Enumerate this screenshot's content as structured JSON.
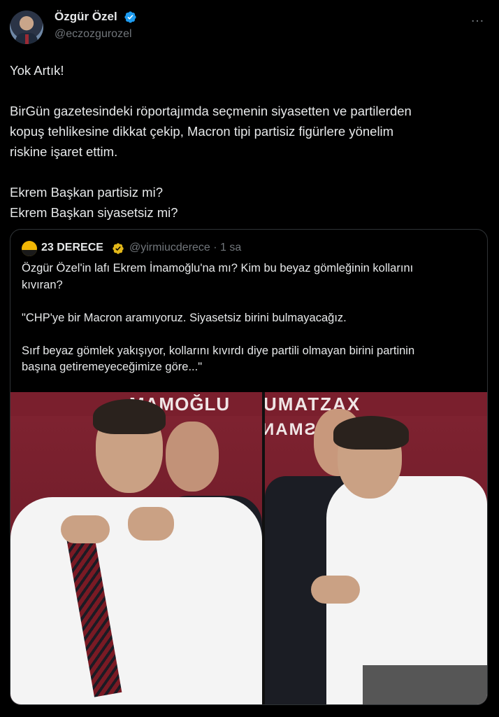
{
  "author": {
    "name": "Özgür Özel",
    "handle": "@eczozgurozel",
    "verified_color": "#1d9bf0"
  },
  "more_icon": "…",
  "tweet_lines": [
    "Yok Artık!",
    "",
    "BirGün gazetesindeki röportajımda seçmenin siyasetten ve partilerden",
    "kopuş tehlikesine dikkat çekip, Macron tipi partisiz figürlere yönelim",
    "riskine işaret ettim.",
    "",
    "Ekrem Başkan partisiz mi?",
    "Ekrem Başkan siyasetsiz mi?"
  ],
  "quoted": {
    "name": "23 DERECE",
    "handle_time": "@yirmiucderece · 1 sa",
    "badge_color": "#e2b719",
    "lines": [
      "Özgür Özel'in lafı Ekrem İmamoğlu'na mı? Kim bu beyaz gömleğinin kollarını",
      "kıvıran?",
      "",
      "\"CHP'ye bir Macron aramıyoruz. Siyasetsiz birini bulmayacağız.",
      "",
      "Sırf beyaz gömlek yakışıyor, kollarını kıvırdı diye partili olmayan birini partinin",
      "başına getiremeyeceğimize göre...\""
    ],
    "photo_sign_left": "MAMOĞLU",
    "photo_sign_right": "UMATZAX",
    "photo_sign_right2": "ИAMƧA"
  }
}
